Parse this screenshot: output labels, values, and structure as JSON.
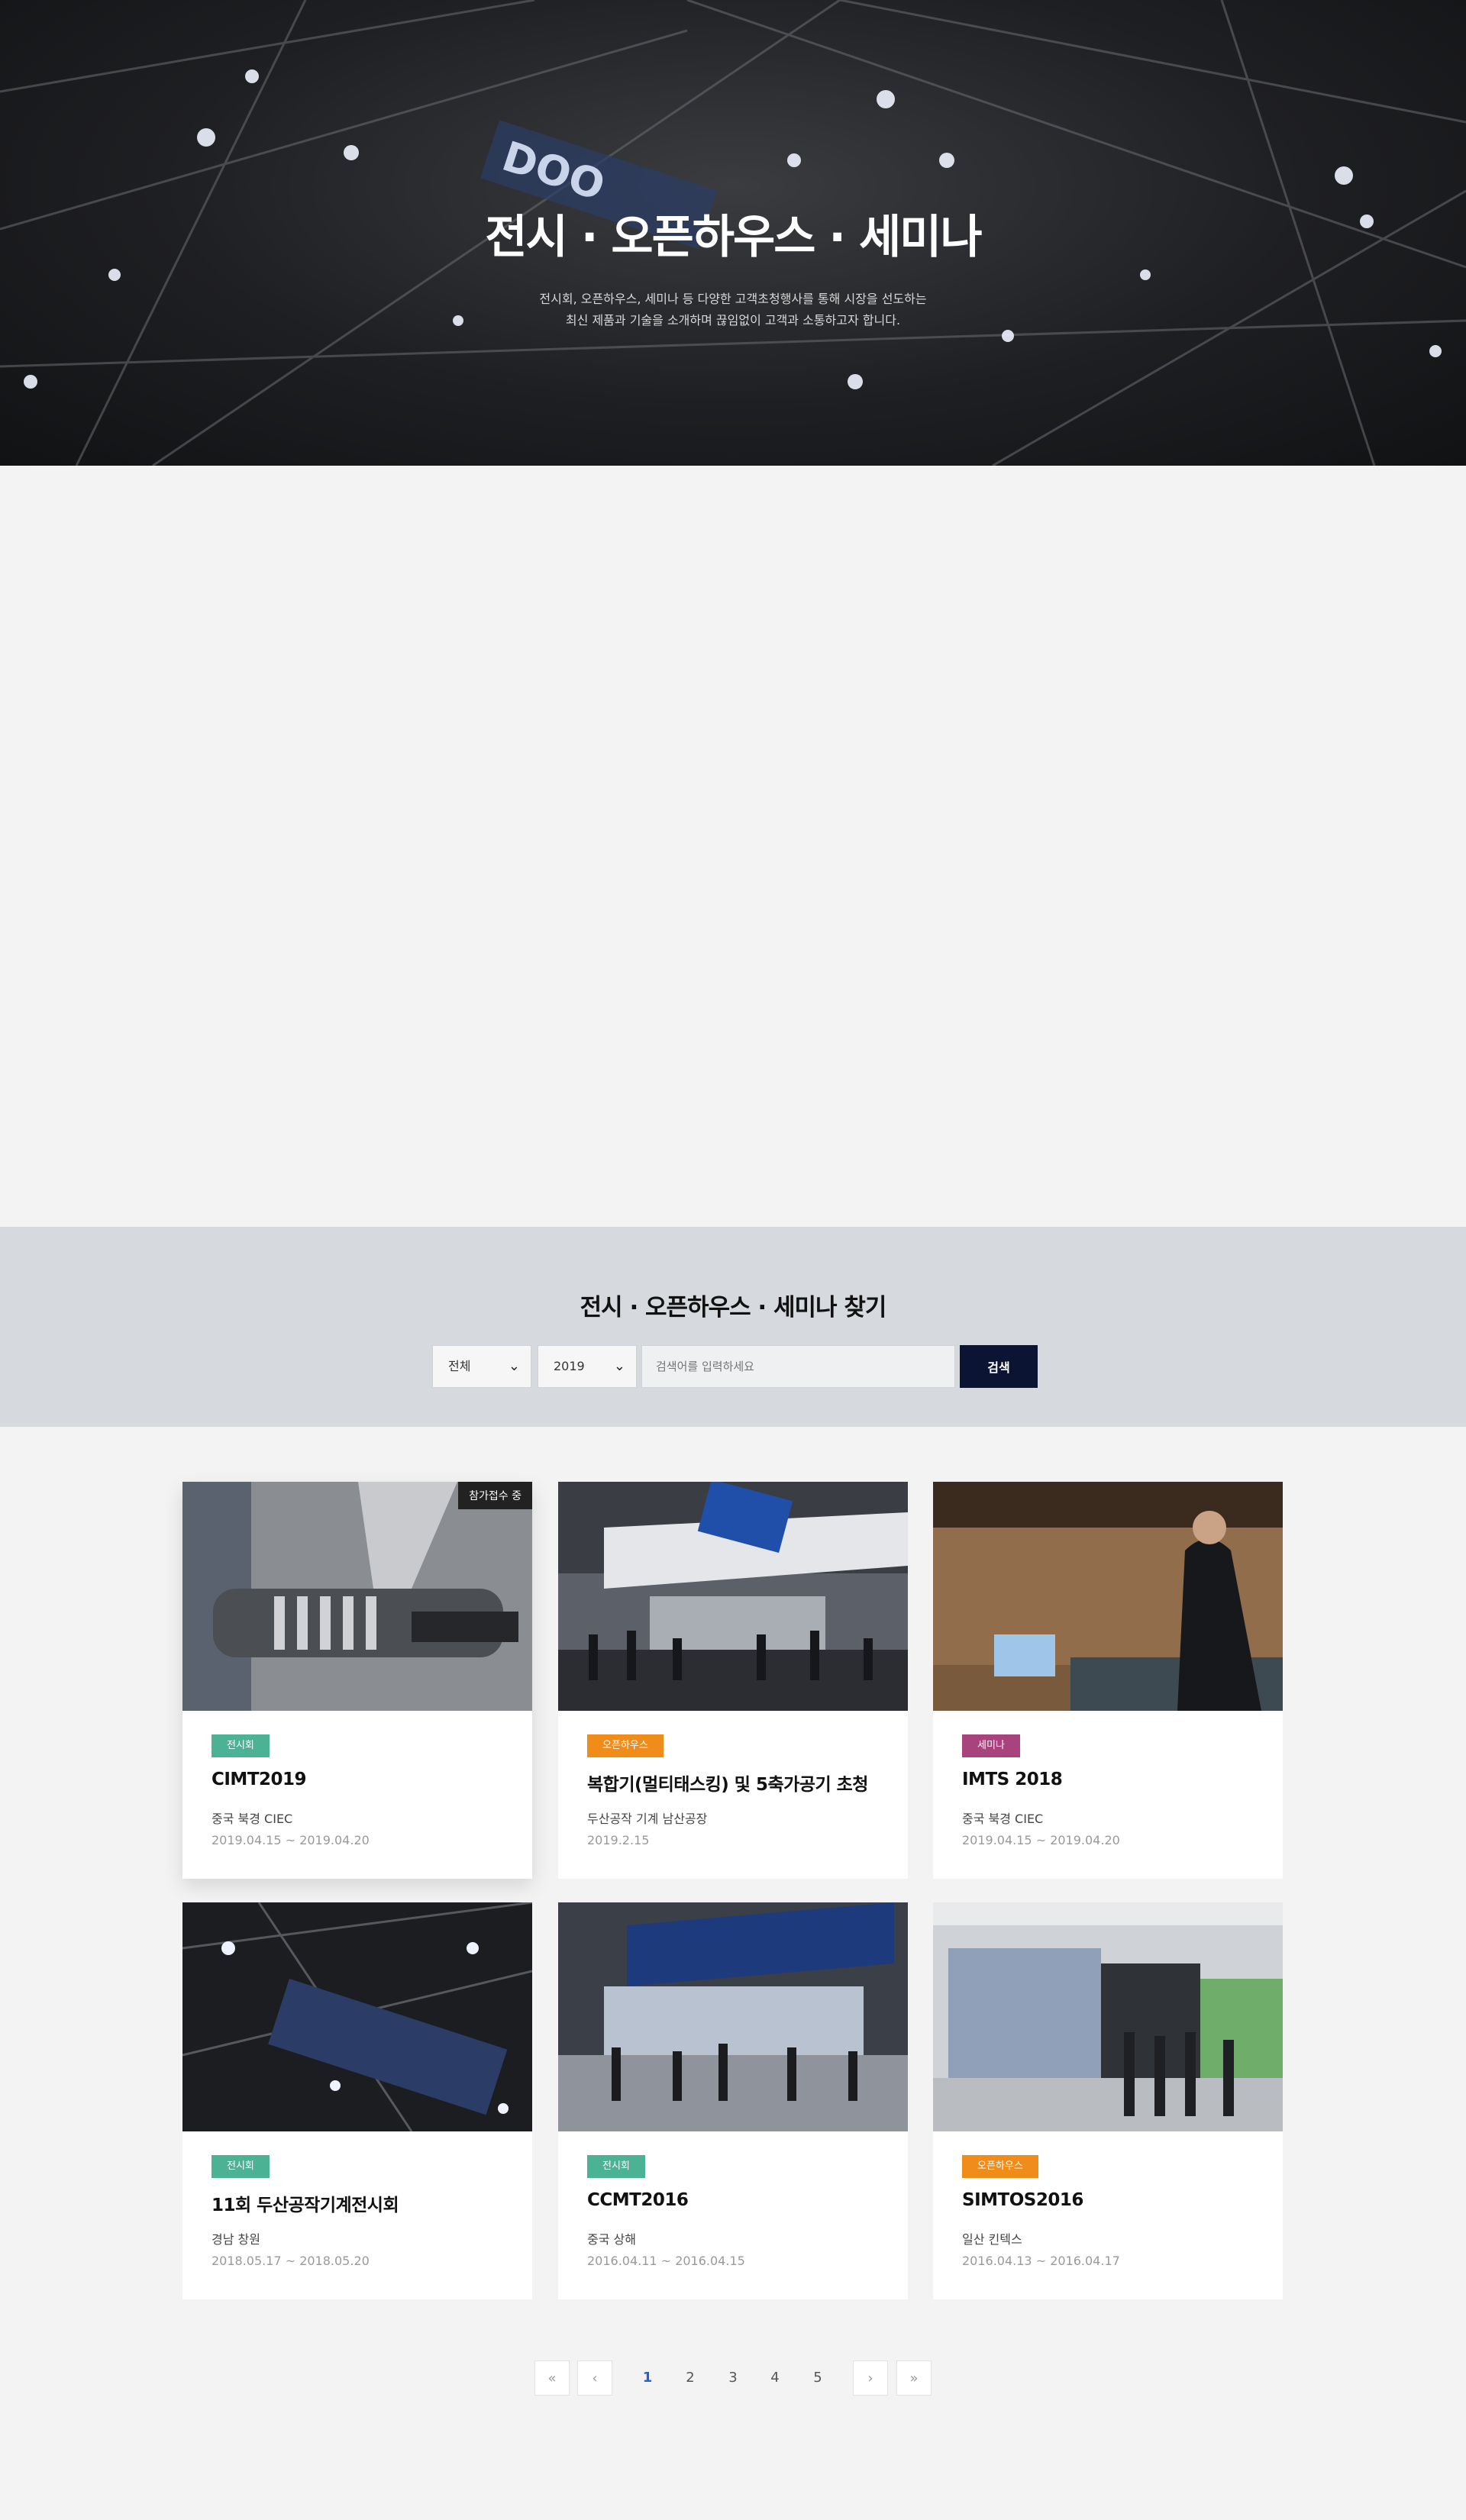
{
  "hero": {
    "title": "전시 · 오픈하우스 · 세미나",
    "desc_line1": "전시회, 오픈하우스, 세미나 등 다양한 고객초청행사를 통해 시장을 선도하는",
    "desc_line2": "최신 제품과 기술을 소개하며 끊임없이 고객과 소통하고자 합니다."
  },
  "search": {
    "title": "전시 · 오픈하우스 · 세미나 찾기",
    "category_value": "전체",
    "year_value": "2019",
    "input_placeholder": "검색어를 입력하세요",
    "button_label": "검색"
  },
  "colors": {
    "badge_exhibition": "#4bb393",
    "badge_openhouse": "#f08c1a",
    "badge_seminar": "#a8437e",
    "search_button": "#0c1433",
    "page_active": "#2a5fd1"
  },
  "cards": [
    {
      "recruit_label": "참가접수 중",
      "badge": "전시회",
      "title": "CIMT2019",
      "place": "중국 북경 CIEC",
      "date": "2019.04.15 ~ 2019.04.20"
    },
    {
      "badge": "오픈하우스",
      "title": "복합기(멀티태스킹) 및 5축가공기 초청",
      "place": "두산공작 기계 남산공장",
      "date": "2019.2.15"
    },
    {
      "badge": "세미나",
      "title": "IMTS 2018",
      "place": "중국 북경 CIEC",
      "date": "2019.04.15 ~ 2019.04.20"
    },
    {
      "badge": "전시회",
      "title": "11회 두산공작기계전시회",
      "place": "경남 창원",
      "date": "2018.05.17 ~ 2018.05.20"
    },
    {
      "badge": "전시회",
      "title": "CCMT2016",
      "place": "중국 상해",
      "date": "2016.04.11 ~ 2016.04.15"
    },
    {
      "badge": "오픈하우스",
      "title": "SIMTOS2016",
      "place": "일산 킨텍스",
      "date": "2016.04.13 ~ 2016.04.17"
    }
  ],
  "pagination": {
    "first_icon": "double-chevron-left-icon",
    "prev_icon": "chevron-left-icon",
    "next_icon": "chevron-right-icon",
    "last_icon": "double-chevron-right-icon",
    "pages": [
      "1",
      "2",
      "3",
      "4",
      "5"
    ],
    "current": "1"
  }
}
